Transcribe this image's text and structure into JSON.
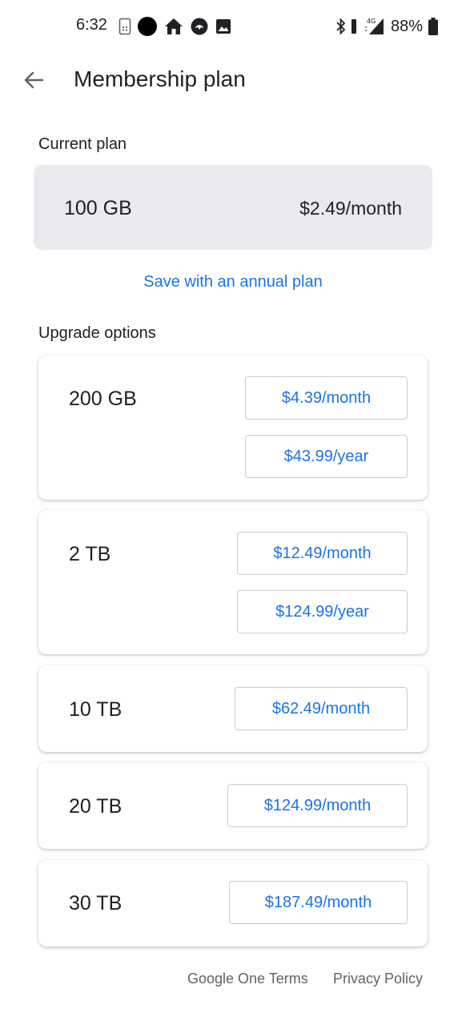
{
  "status_bar": {
    "time": "6:32",
    "network": "4G",
    "battery": "88%"
  },
  "app_bar": {
    "title": "Membership plan",
    "back_icon": "arrow-back-icon"
  },
  "current_plan": {
    "heading": "Current plan",
    "size": "100 GB",
    "price": "$2.49/month"
  },
  "annual_link": "Save with an annual plan",
  "upgrade": {
    "heading": "Upgrade options",
    "plans": [
      {
        "size": "200 GB",
        "monthly": "$4.39/month",
        "yearly": "$43.99/year"
      },
      {
        "size": "2 TB",
        "monthly": "$12.49/month",
        "yearly": "$124.99/year"
      },
      {
        "size": "10 TB",
        "monthly": "$62.49/month"
      },
      {
        "size": "20 TB",
        "monthly": "$124.99/month"
      },
      {
        "size": "30 TB",
        "monthly": "$187.49/month"
      }
    ]
  },
  "footer": {
    "terms": "Google One Terms",
    "privacy": "Privacy Policy"
  },
  "colors": {
    "accent": "#1a73e8",
    "card_gray": "#e8eaed",
    "text": "#202124",
    "muted": "#5f6368"
  }
}
